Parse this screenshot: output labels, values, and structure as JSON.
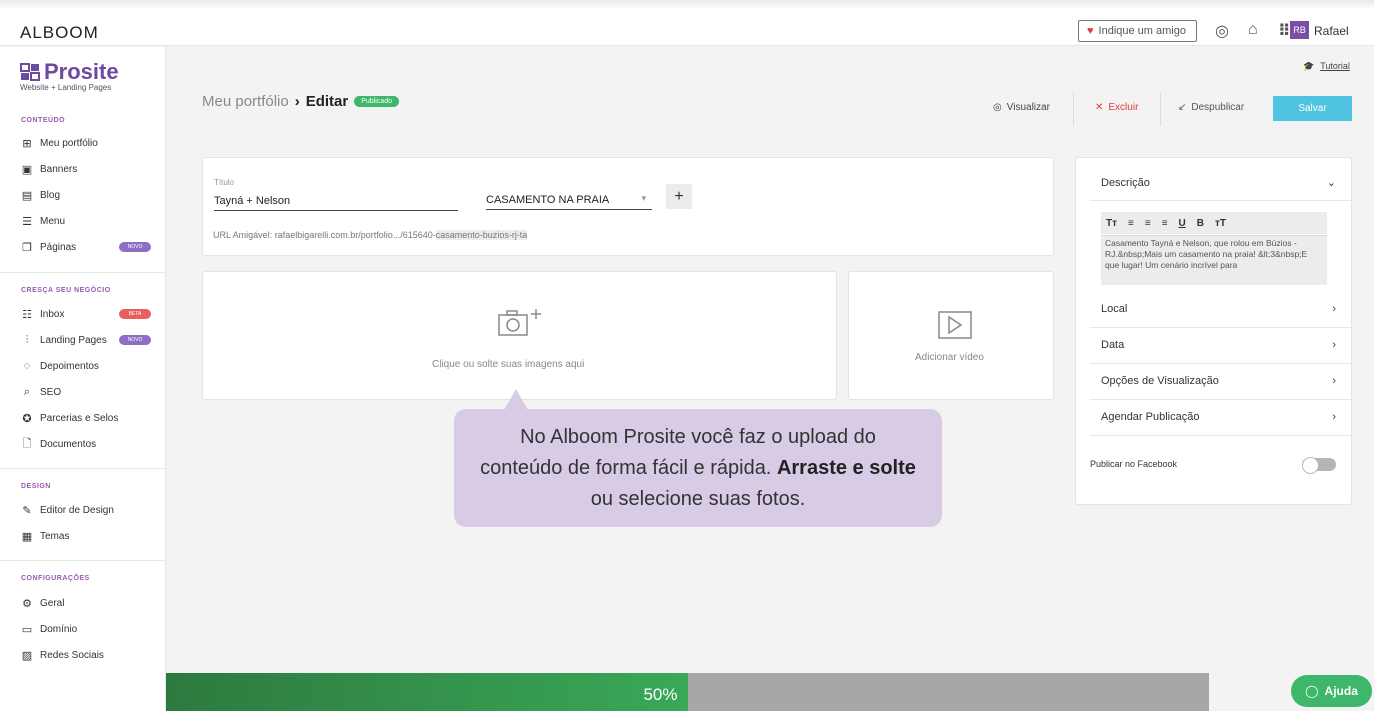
{
  "topbar": {
    "brand": "ALBOOM",
    "indique_label": "Indique um amigo",
    "avatar_initials": "RB",
    "user_name": "Rafael"
  },
  "sidebar": {
    "logo_text": "Prosite",
    "logo_sub": "Website + Landing Pages",
    "sections": [
      {
        "title": "CONTEÚDO"
      },
      {
        "title": "CRESÇA SEU NEGÓCIO"
      },
      {
        "title": "DESIGN"
      },
      {
        "title": "CONFIGURAÇÕES"
      }
    ],
    "items": [
      {
        "label": "Meu portfólio",
        "icon": "grid-icon"
      },
      {
        "label": "Banners",
        "icon": "image-icon"
      },
      {
        "label": "Blog",
        "icon": "blog-icon"
      },
      {
        "label": "Menu",
        "icon": "menu-icon"
      },
      {
        "label": "Páginas",
        "icon": "pages-icon",
        "badge": "NOVO"
      },
      {
        "label": "Inbox",
        "icon": "inbox-icon",
        "badge": "BETA"
      },
      {
        "label": "Landing Pages",
        "icon": "landing-icon",
        "badge": "NOVO"
      },
      {
        "label": "Depoimentos",
        "icon": "chat-icon"
      },
      {
        "label": "SEO",
        "icon": "seo-icon"
      },
      {
        "label": "Parcerias e Selos",
        "icon": "seal-icon"
      },
      {
        "label": "Documentos",
        "icon": "document-icon"
      },
      {
        "label": "Editor de Design",
        "icon": "brush-icon"
      },
      {
        "label": "Temas",
        "icon": "theme-icon"
      },
      {
        "label": "Geral",
        "icon": "gear-icon"
      },
      {
        "label": "Domínio",
        "icon": "domain-icon"
      },
      {
        "label": "Redes Sociais",
        "icon": "social-icon"
      }
    ],
    "badge_colors": {
      "novo": "#8d6fc4",
      "beta": "#e95f5f"
    }
  },
  "header": {
    "crumb_parent": "Meu portfólio",
    "crumb_sep": "›",
    "crumb_current": "Editar",
    "status": "Publicado",
    "tutorial": "Tutorial",
    "visualizar": "Visualizar",
    "excluir": "Excluir",
    "despublicar": "Despublicar",
    "salvar": "Salvar"
  },
  "form": {
    "title_label": "Título",
    "title_value": "Tayná + Nelson",
    "category_value": "CASAMENTO NA PRAIA",
    "plus": "+",
    "url_prefix": "URL Amigável: rafaelbigarelli.com.br/portfolio.../615640-",
    "url_slug": "casamento-buzios-rj-ta"
  },
  "upload": {
    "images_text": "Clique ou solte suas imagens aqui",
    "video_text": "Adicionar vídeo"
  },
  "panel": {
    "descricao": "Descrição",
    "editor_text": "Casamento Tayná e Nelson, que rolou em Búzios - RJ.&nbsp;Mais um casamento na praia! &lt;3&nbsp;E que lugar! Um cenário incrível para",
    "rows": [
      "Local",
      "Data",
      "Opções de Visualização",
      "Agendar Publicação"
    ],
    "facebook": "Publicar no Facebook"
  },
  "tooltip": {
    "part1": "No Alboom Prosite você faz o upload do conteúdo de forma fácil e rápida.",
    "bold": "Arraste e solte",
    "part2": "ou selecione suas fotos."
  },
  "progress": {
    "value": 0.5,
    "label": "50%"
  },
  "help": {
    "label": "Ajuda"
  },
  "colors": {
    "accent": "#6b4aa0",
    "save": "#4fc3e0",
    "green": "#3eb76a",
    "danger": "#e53935"
  }
}
